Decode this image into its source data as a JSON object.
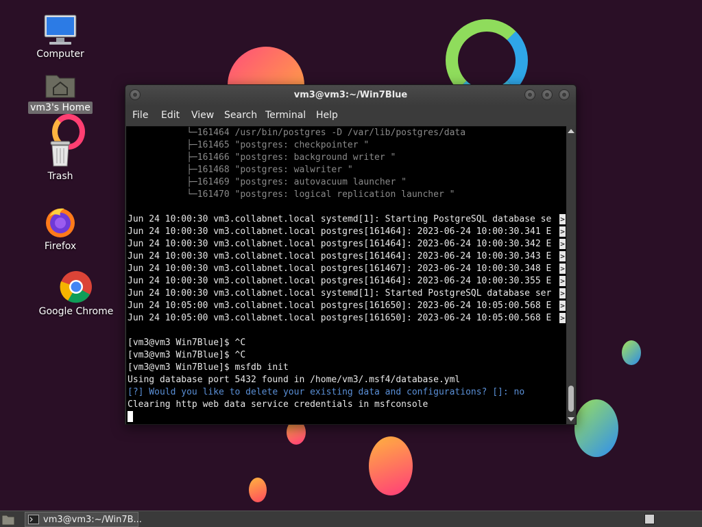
{
  "desktop": {
    "icons": [
      {
        "label": "Computer",
        "icon": "computer-icon"
      },
      {
        "label": "vm3's Home",
        "icon": "home-folder-icon"
      },
      {
        "label": "Trash",
        "icon": "trash-icon"
      },
      {
        "label": "Firefox",
        "icon": "firefox-icon"
      },
      {
        "label": "Google Chrome",
        "icon": "chrome-icon"
      }
    ]
  },
  "terminal": {
    "title": "vm3@vm3:~/Win7Blue",
    "menu": [
      "File",
      "Edit",
      "View",
      "Search",
      "Terminal",
      "Help"
    ],
    "lines": [
      "           └─161464 /usr/bin/postgres -D /var/lib/postgres/data",
      "           ├─161465 \"postgres: checkpointer \"",
      "           ├─161466 \"postgres: background writer \"",
      "           ├─161468 \"postgres: walwriter \"",
      "           ├─161469 \"postgres: autovacuum launcher \"",
      "           └─161470 \"postgres: logical replication launcher \"",
      "",
      "Jun 24 10:00:30 vm3.collabnet.local systemd[1]: Starting PostgreSQL database se",
      "Jun 24 10:00:30 vm3.collabnet.local postgres[161464]: 2023-06-24 10:00:30.341 E",
      "Jun 24 10:00:30 vm3.collabnet.local postgres[161464]: 2023-06-24 10:00:30.342 E",
      "Jun 24 10:00:30 vm3.collabnet.local postgres[161464]: 2023-06-24 10:00:30.343 E",
      "Jun 24 10:00:30 vm3.collabnet.local postgres[161467]: 2023-06-24 10:00:30.348 E",
      "Jun 24 10:00:30 vm3.collabnet.local postgres[161464]: 2023-06-24 10:00:30.355 E",
      "Jun 24 10:00:30 vm3.collabnet.local systemd[1]: Started PostgreSQL database ser",
      "Jun 24 10:05:00 vm3.collabnet.local postgres[161650]: 2023-06-24 10:05:00.568 E",
      "Jun 24 10:05:00 vm3.collabnet.local postgres[161650]: 2023-06-24 10:05:00.568 E",
      "",
      "[vm3@vm3 Win7Blue]$ ^C",
      "[vm3@vm3 Win7Blue]$ ^C",
      "[vm3@vm3 Win7Blue]$ msfdb init",
      "Using database port 5432 found in /home/vm3/.msf4/database.yml",
      "[?] Would you like to delete your existing data and configurations? []: no",
      "Clearing http web data service credentials in msfconsole"
    ],
    "truncation_marker": ">"
  },
  "taskbar": {
    "task_label": "vm3@vm3:~/Win7B..."
  },
  "colors": {
    "background": "#2a0f26",
    "terminal_bg": "#000000",
    "prompt_question": "#5a8fd6"
  }
}
